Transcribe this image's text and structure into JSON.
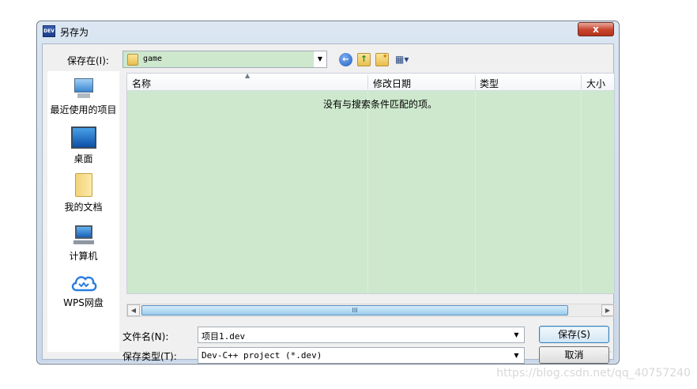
{
  "window": {
    "title": "另存为",
    "app_icon_text": "DEV",
    "close_symbol": "x"
  },
  "location": {
    "label": "保存在(I):",
    "value": "game"
  },
  "toolbar": {
    "back": "back-icon",
    "up": "up-folder-icon",
    "new_folder": "new-folder-icon",
    "views": "views-menu-icon"
  },
  "places": [
    {
      "label": "最近使用的项目",
      "icon": "recent-items-icon"
    },
    {
      "label": "桌面",
      "icon": "desktop-icon"
    },
    {
      "label": "我的文档",
      "icon": "my-documents-icon"
    },
    {
      "label": "计算机",
      "icon": "computer-icon"
    },
    {
      "label": "WPS网盘",
      "icon": "wps-cloud-icon"
    }
  ],
  "file_list": {
    "columns": [
      "名称",
      "修改日期",
      "类型",
      "大小"
    ],
    "empty_message": "没有与搜索条件匹配的项。"
  },
  "filename": {
    "label": "文件名(N):",
    "value": "项目1.dev"
  },
  "filetype": {
    "label": "保存类型(T):",
    "value": "Dev-C++ project (*.dev)"
  },
  "buttons": {
    "save": "保存(S)",
    "cancel": "取消"
  },
  "watermark": "https://blog.csdn.net/qq_40757240",
  "colors": {
    "list_background": "#cde8cd",
    "dialog_frame": "#c9d8ea",
    "close_button": "#c7432c"
  }
}
